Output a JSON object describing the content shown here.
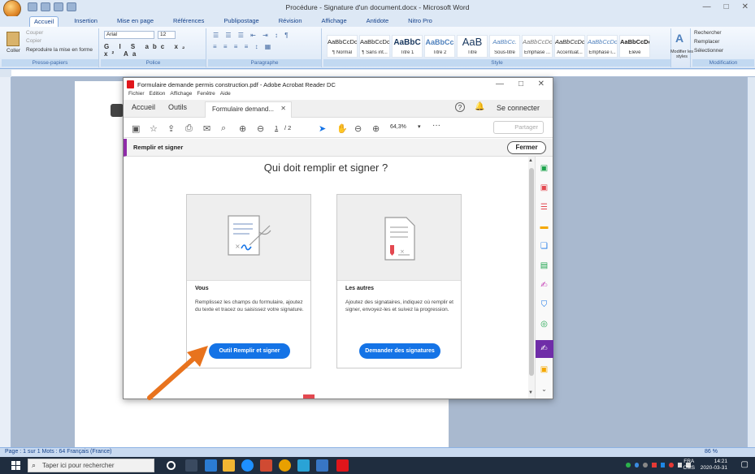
{
  "word": {
    "title": "Procédure - Signature d'un document.docx - Microsoft Word",
    "tabs": [
      "Accueil",
      "Insertion",
      "Mise en page",
      "Références",
      "Publipostage",
      "Révision",
      "Affichage",
      "Antidote",
      "Nitro Pro"
    ],
    "clipboard": {
      "cut": "Couper",
      "copy": "Copier",
      "paste": "Coller",
      "format": "Reproduire la mise en forme",
      "label": "Presse-papiers"
    },
    "font": {
      "name": "Arial",
      "size": "12",
      "label": "Police"
    },
    "paragraph_label": "Paragraphe",
    "styles": [
      {
        "sample": "AaBbCcDc",
        "name": "¶ Normal"
      },
      {
        "sample": "AaBbCcDc",
        "name": "¶ Sans int..."
      },
      {
        "sample": "AaBbC",
        "name": "Titre 1"
      },
      {
        "sample": "AaBbCc",
        "name": "Titre 2"
      },
      {
        "sample": "AaB",
        "name": "Titre"
      },
      {
        "sample": "AaBbCc.",
        "name": "Sous-titre"
      },
      {
        "sample": "AaBbCcDc",
        "name": "Emphase ..."
      },
      {
        "sample": "AaBbCcDc",
        "name": "Accentuat..."
      },
      {
        "sample": "AaBbCcDc",
        "name": "Emphase i..."
      },
      {
        "sample": "AaBbCcDc",
        "name": "Élevé"
      }
    ],
    "styles_label": "Style",
    "modify_styles": "Modifier les styles",
    "editing": {
      "find": "Rechercher",
      "replace": "Remplacer",
      "select": "Sélectionner",
      "label": "Modification"
    },
    "status": "Page : 1 sur 1   Mots : 64      Français (France)",
    "zoom": "86 %"
  },
  "taskbar": {
    "search_placeholder": "Taper ici pour rechercher",
    "lang": "FRA",
    "lang2": "CMS",
    "time": "14:21",
    "date": "2020-03-31"
  },
  "acrobat": {
    "title": "Formulaire demande permis construction.pdf - Adobe Acrobat Reader DC",
    "menu": [
      "Fichier",
      "Edition",
      "Affichage",
      "Fenêtre",
      "Aide"
    ],
    "tabs": {
      "home": "Accueil",
      "tools": "Outils",
      "doc": "Formulaire demand..."
    },
    "sign_in": "Se connecter",
    "share": "Partager",
    "page_current": "1",
    "page_total": "/ 2",
    "zoom": "64,3%",
    "fill_sign_title": "Remplir et signer",
    "close_label": "Fermer",
    "who_title": "Qui doit remplir et signer ?",
    "cards": [
      {
        "title": "Vous",
        "desc": "Remplissez les champs du formulaire, ajoutez du texte et tracez ou saisissez votre signature.",
        "button": "Outil Remplir et signer"
      },
      {
        "title": "Les autres",
        "desc": "Ajoutez des signataires, indiquez où remplir et signer, envoyez-les et suivez la progression.",
        "button": "Demander des signatures"
      }
    ]
  },
  "colors": {
    "accent": "#1473e6",
    "purple": "#6f2da8",
    "arrow": "#e8731e"
  }
}
